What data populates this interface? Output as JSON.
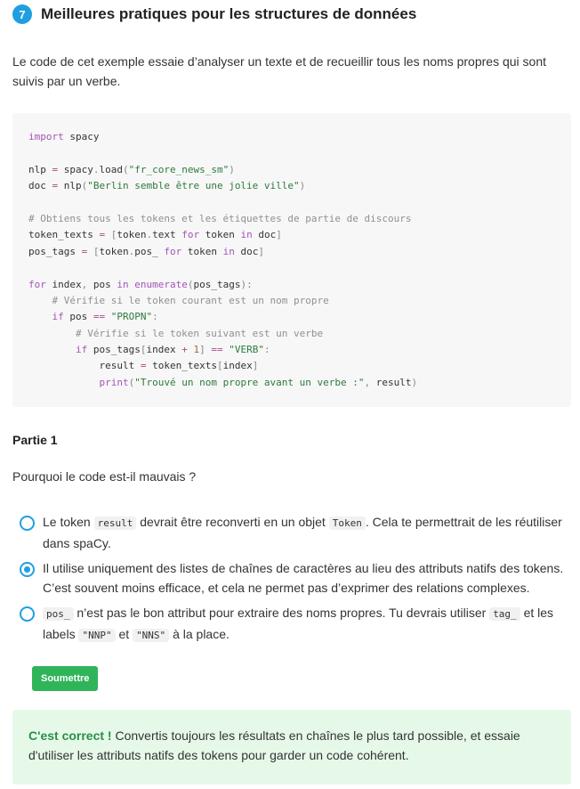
{
  "header": {
    "number": "7",
    "title": "Meilleures pratiques pour les structures de données"
  },
  "intro": "Le code de cet exemple essaie d’analyser un texte et de recueillir tous les noms propres qui sont suivis par un verbe.",
  "code": {
    "l1": "import spacy",
    "l3a": "nlp = spacy.load(",
    "l3b": "\"fr_core_news_sm\"",
    "l3c": ")",
    "l4a": "doc = nlp(",
    "l4b": "\"Berlin semble être une jolie ville\"",
    "l4c": ")",
    "l6": "# Obtiens tous les tokens et les étiquettes de partie de discours",
    "l7": "token_texts = [token.text for token in doc]",
    "l8": "pos_tags = [token.pos_ for token in doc]",
    "l10": "for index, pos in enumerate(pos_tags):",
    "l11": "    # Vérifie si le token courant est un nom propre",
    "l12": "    if pos == \"PROPN\":",
    "l13": "        # Vérifie si le token suivant est un verbe",
    "l14": "        if pos_tags[index + 1] == \"VERB\":",
    "l15": "            result = token_texts[index]",
    "l16": "            print(\"Trouvé un nom propre avant un verbe :\", result)"
  },
  "part": "Partie 1",
  "question": "Pourquoi le code est-il mauvais ?",
  "options": [
    {
      "before": "Le token ",
      "code1": "result",
      "middle": " devrait être reconverti en un objet ",
      "code2": "Token",
      "after": ". Cela te permettrait de les réutiliser dans spaCy.",
      "checked": false
    },
    {
      "text": "Il utilise uniquement des listes de chaînes de caractères au lieu des attributs natifs des tokens. C’est souvent moins efficace, et cela ne permet pas d’exprimer des relations complexes.",
      "checked": true
    },
    {
      "code1": "pos_",
      "middle": " n’est pas le bon attribut pour extraire des noms propres. Tu devrais utiliser ",
      "code2": "tag_",
      "middle2": " et les labels ",
      "code3": "\"NNP\"",
      "middle3": " et ",
      "code4": "\"NNS\"",
      "after": " à la place.",
      "checked": false
    }
  ],
  "submit_label": "Soumettre",
  "feedback": {
    "label": "C'est correct !",
    "text": " Convertis toujours les résultats en chaînes le plus tard possible, et essaie d'utiliser les attributs natifs des tokens pour garder un code cohérent."
  },
  "colors": {
    "accent": "#1f9fe0",
    "submit": "#30b45a",
    "feedback_bg": "#e6f9e9",
    "correct": "#2a8f46"
  }
}
